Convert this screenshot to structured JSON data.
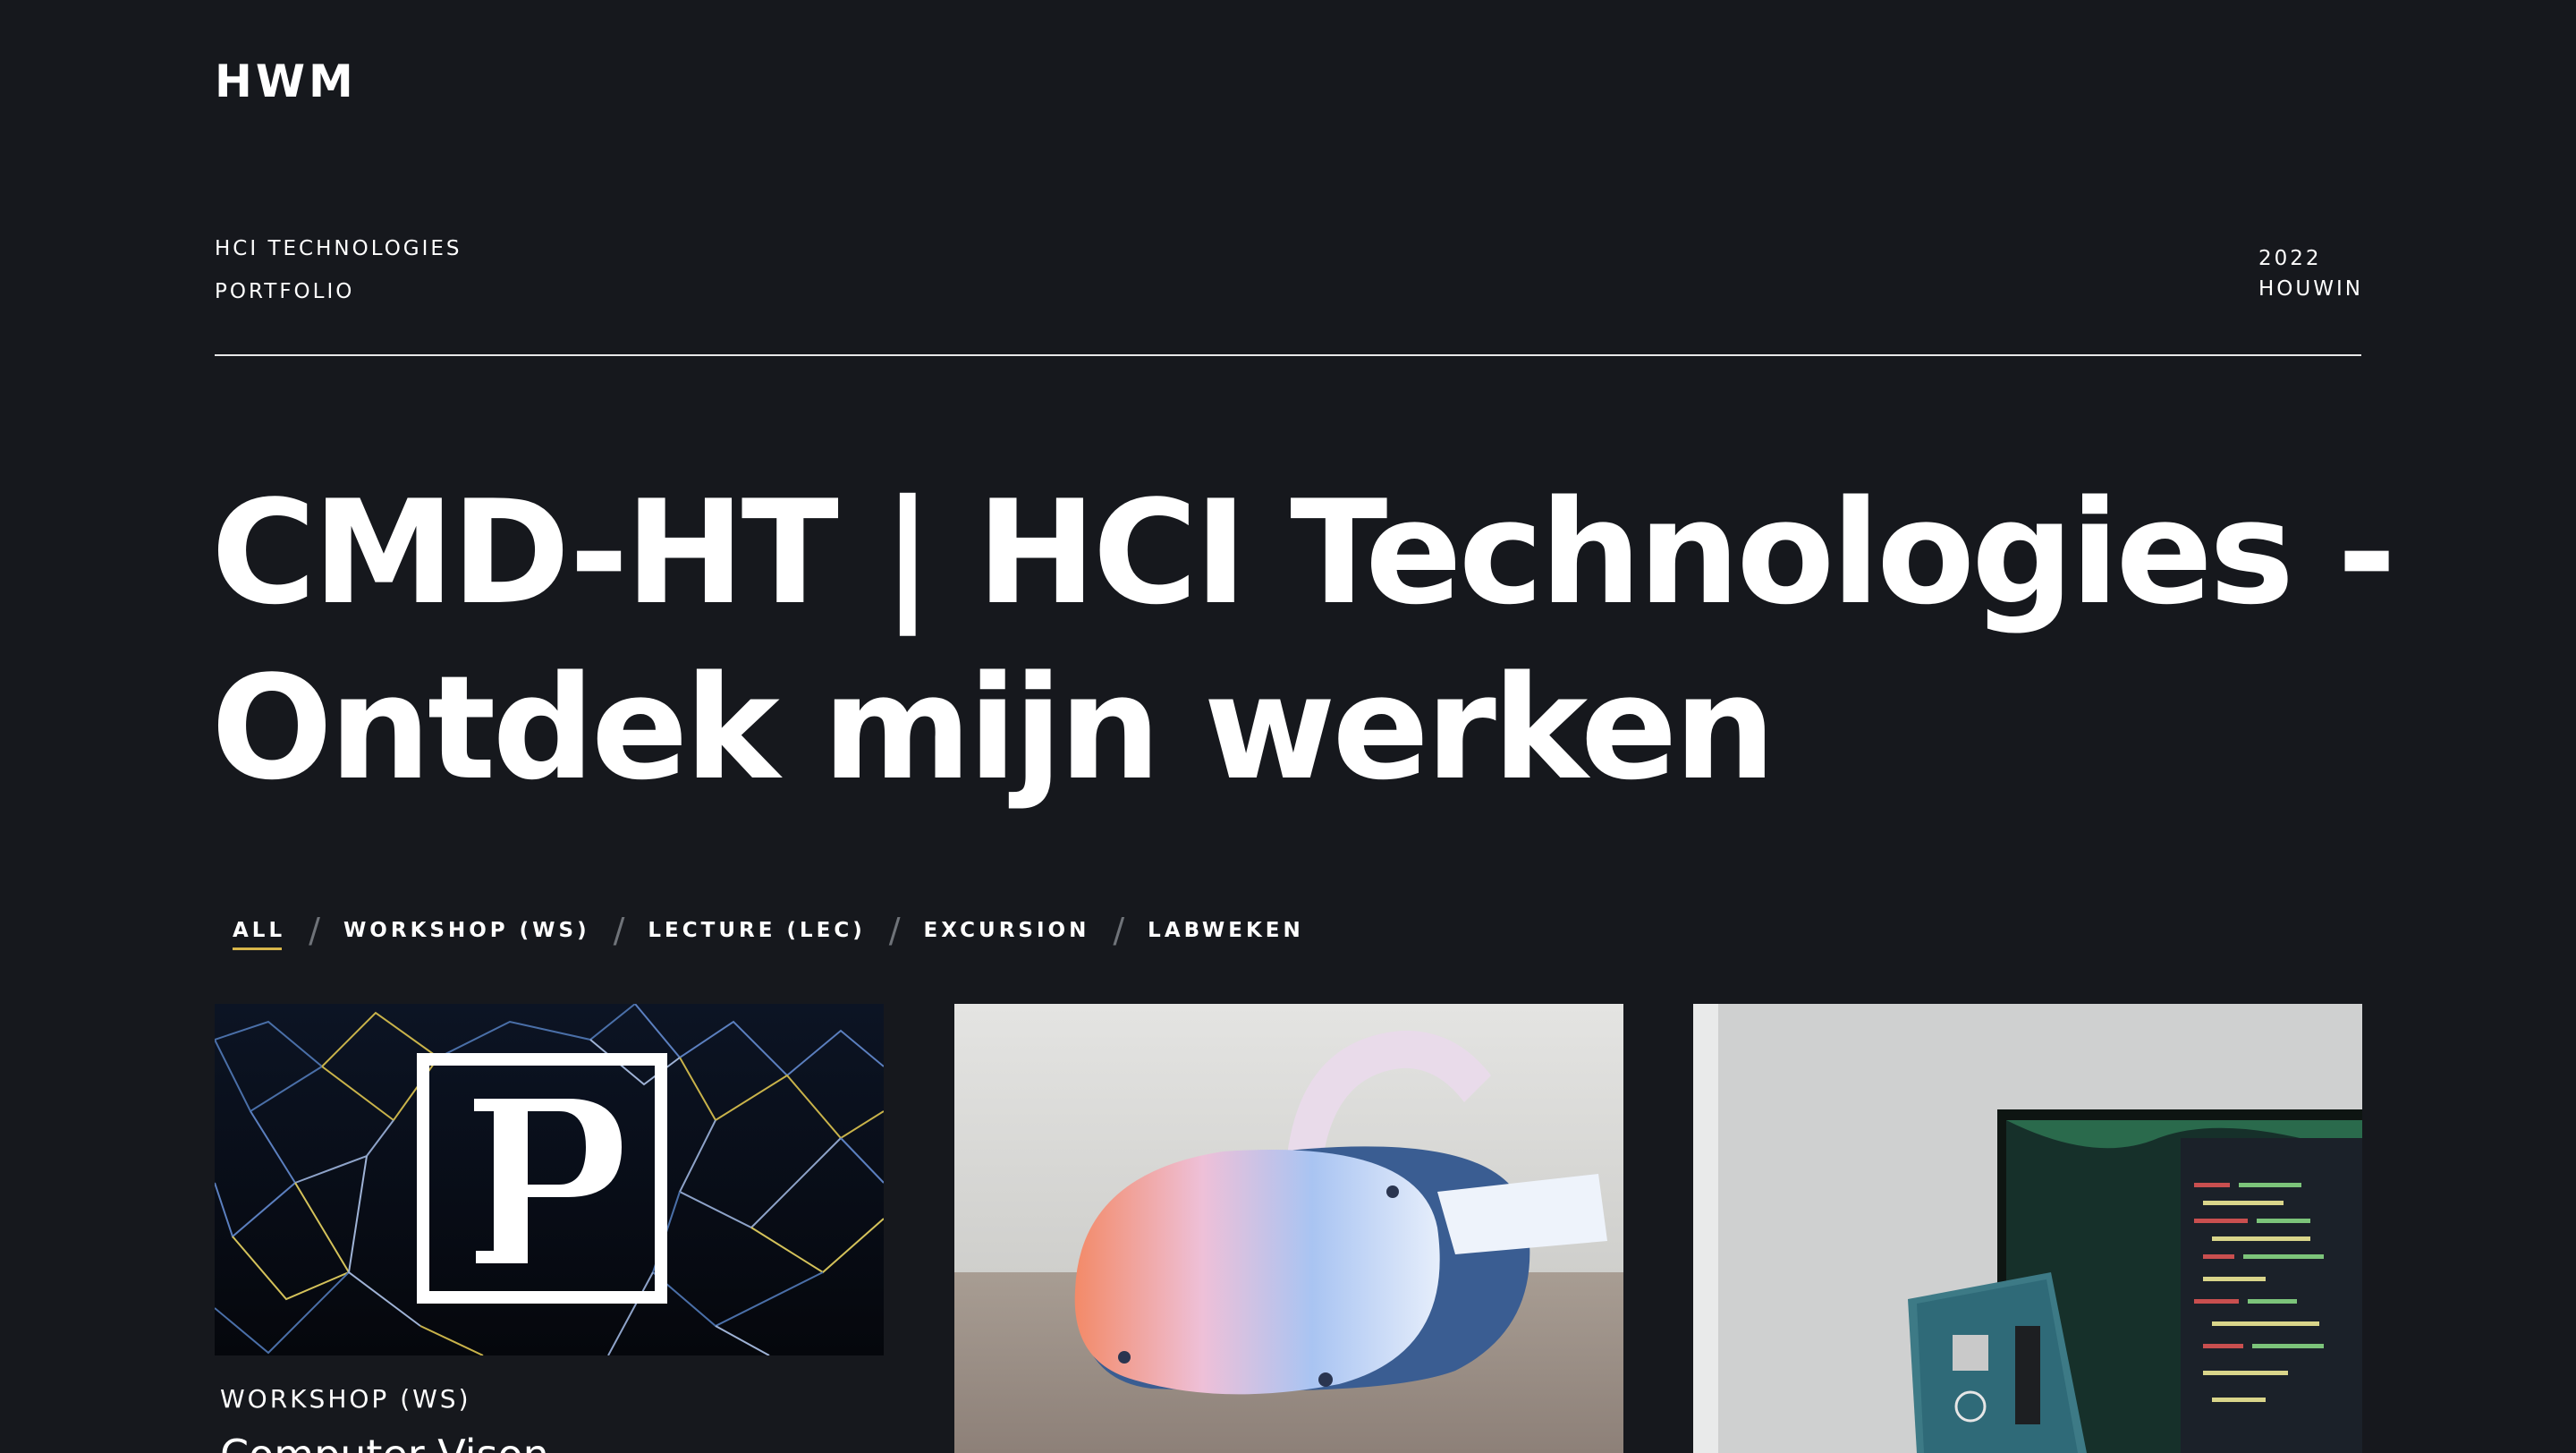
{
  "header": {
    "logo": "HWM",
    "course": "HCI TECHNOLOGIES",
    "section": "PORTFOLIO",
    "year": "2022",
    "author": "HOUWIN"
  },
  "hero": {
    "line1": "CMD-HT | HCI Technologies -",
    "line2": "Ontdek mijn werken"
  },
  "filters": [
    {
      "label": "ALL",
      "active": true
    },
    {
      "label": "WORKSHOP (WS)",
      "active": false
    },
    {
      "label": "LECTURE (LEC)",
      "active": false
    },
    {
      "label": "EXCURSION",
      "active": false
    },
    {
      "label": "LABWEKEN",
      "active": false
    }
  ],
  "cards": [
    {
      "category": "WORKSHOP (WS)",
      "title": "Computer Vison",
      "image": "plexus-logo-image"
    },
    {
      "category": "",
      "title": "",
      "image": "vr-headset-image"
    },
    {
      "category": "",
      "title": "",
      "image": "arduino-monitor-image"
    }
  ],
  "colors": {
    "background": "#16181d",
    "text": "#ffffff",
    "active_underline": "#d8b64a",
    "separator": "#6f7379"
  }
}
